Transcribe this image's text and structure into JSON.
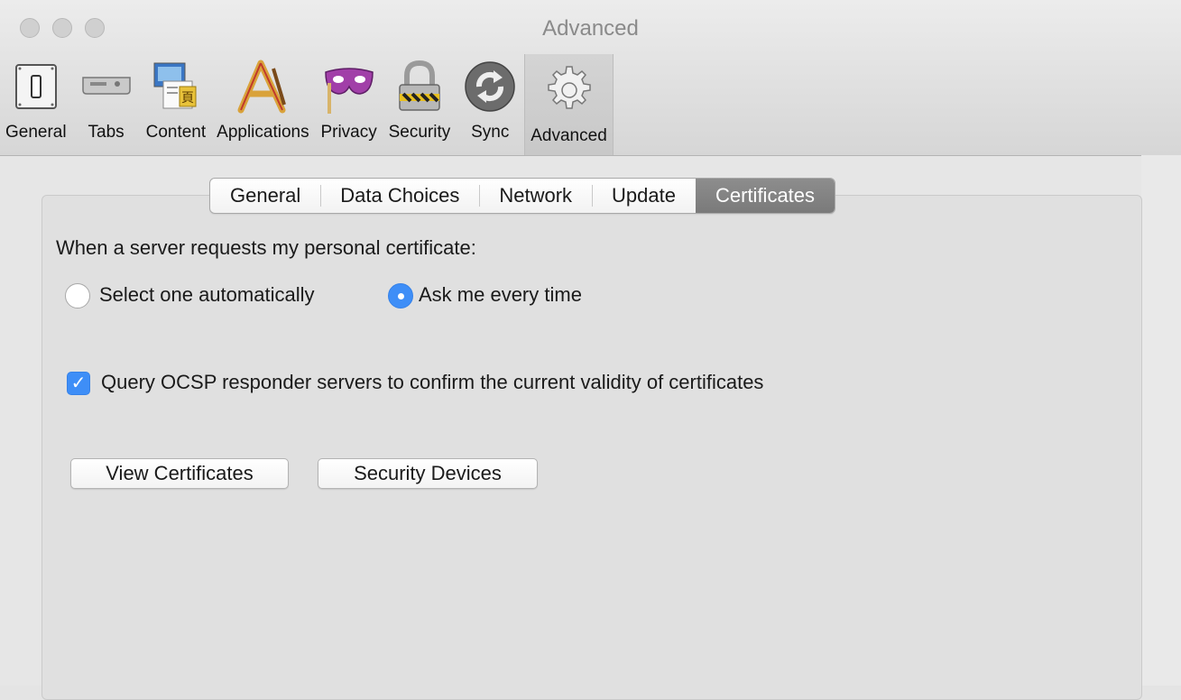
{
  "window": {
    "title": "Advanced"
  },
  "toolbar": {
    "items": [
      {
        "label": "General",
        "icon": "switch-icon"
      },
      {
        "label": "Tabs",
        "icon": "tabs-icon"
      },
      {
        "label": "Content",
        "icon": "content-icon"
      },
      {
        "label": "Applications",
        "icon": "applications-icon"
      },
      {
        "label": "Privacy",
        "icon": "mask-icon"
      },
      {
        "label": "Security",
        "icon": "padlock-icon"
      },
      {
        "label": "Sync",
        "icon": "sync-icon"
      },
      {
        "label": "Advanced",
        "icon": "gear-icon",
        "selected": true
      }
    ]
  },
  "tabs": [
    "General",
    "Data Choices",
    "Network",
    "Update",
    "Certificates"
  ],
  "active_tab": "Certificates",
  "certificates": {
    "request_label": "When a server requests my personal certificate:",
    "option_auto": "Select one automatically",
    "option_ask": "Ask me every time",
    "selected_option": "Ask me every time",
    "ocsp_label": "Query OCSP responder servers to confirm the current validity of certificates",
    "ocsp_checked": true,
    "view_button": "View Certificates",
    "devices_button": "Security Devices"
  },
  "colors": {
    "accent": "#3e8ef7",
    "active_tab": "#838383"
  }
}
